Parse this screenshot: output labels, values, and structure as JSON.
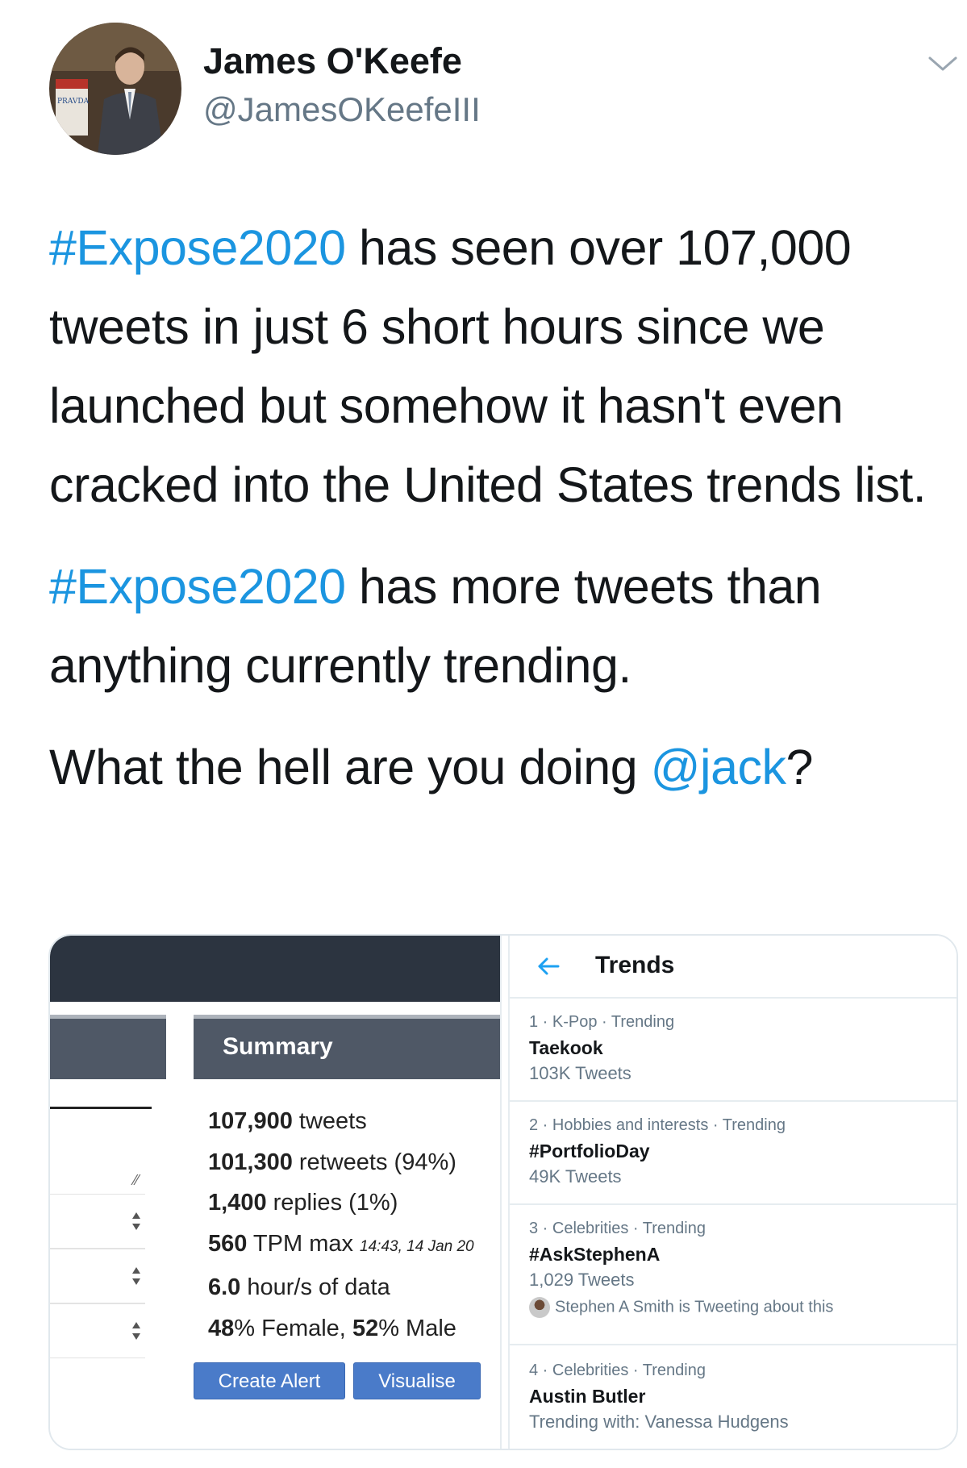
{
  "author": {
    "name": "James O'Keefe",
    "handle": "@JamesOKeefeIII",
    "avatar_sign_text": "PRAVDA"
  },
  "tweet": {
    "paragraph1": {
      "hashtag": "#Expose2020",
      "text": " has seen over 107,000 tweets in just 6 short hours since we launched but somehow it hasn't even cracked into the United States trends list."
    },
    "paragraph2": {
      "hashtag": "#Expose2020",
      "text": " has more tweets than anything currently trending."
    },
    "paragraph3": {
      "text": "What the hell are you doing ",
      "mention": "@jack",
      "suffix": "?"
    }
  },
  "analytics": {
    "summary_title": "Summary",
    "stats": [
      {
        "value": "107,900",
        "label": " tweets"
      },
      {
        "value": "101,300",
        "label": " retweets (94%)"
      },
      {
        "value": "1,400",
        "label": " replies (1%)"
      },
      {
        "value": "560",
        "label": " TPM max ",
        "note": "14:43, 14 Jan 20"
      },
      {
        "value": "6.0",
        "label": " hour/s of data"
      },
      {
        "value": "48",
        "label": "% Female, ",
        "value2": "52",
        "label2": "% Male"
      }
    ],
    "create_alert_label": "Create Alert",
    "visualise_label": "Visualise"
  },
  "trends": {
    "title": "Trends",
    "items": [
      {
        "meta": "1 · K-Pop · Trending",
        "name": "Taekook",
        "count": "103K Tweets"
      },
      {
        "meta": "2 · Hobbies and interests · Trending",
        "name": "#PortfolioDay",
        "count": "49K Tweets"
      },
      {
        "meta": "3 · Celebrities · Trending",
        "name": "#AskStephenA",
        "count": "1,029 Tweets",
        "note": "Stephen A Smith is Tweeting about this"
      },
      {
        "meta": "4 · Celebrities · Trending",
        "name": "Austin Butler",
        "count": "Trending with: Vanessa Hudgens"
      }
    ]
  },
  "colors": {
    "link": "#1b95e0",
    "secondary_text": "#657786",
    "topbar": "#2c3440",
    "summary_header": "#4f5866",
    "button": "#4a7bc9"
  },
  "icons": {
    "more": "chevron-down-icon",
    "back": "arrow-left-icon",
    "select": "sort-arrows-icon"
  }
}
